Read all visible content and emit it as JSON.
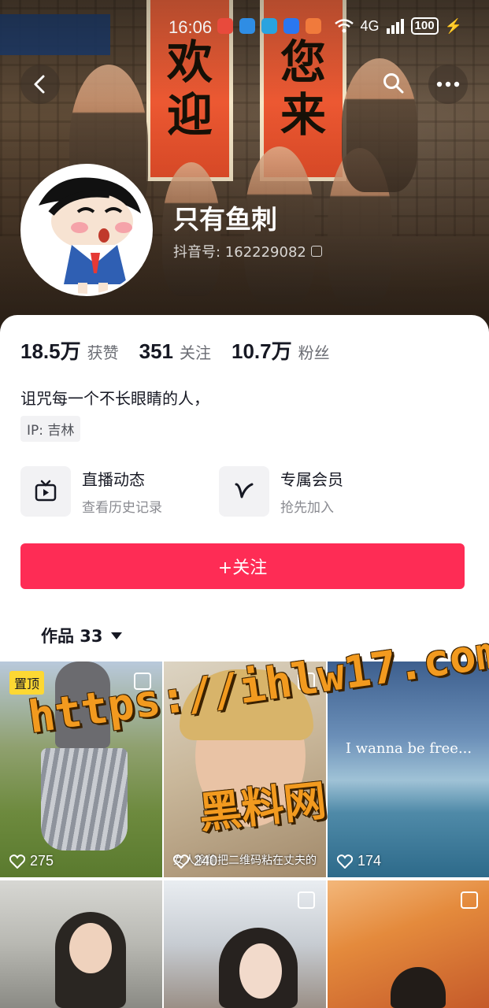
{
  "status_bar": {
    "time": "16:06",
    "network": "4G",
    "battery": "100"
  },
  "banner": {
    "scroll_left": [
      "欢",
      "迎"
    ],
    "scroll_right": [
      "您",
      "来"
    ]
  },
  "profile": {
    "nickname": "只有鱼刺",
    "douyin_id_label": "抖音号: 162229082"
  },
  "stats": [
    {
      "num": "18.5万",
      "label": "获赞"
    },
    {
      "num": "351",
      "label": "关注"
    },
    {
      "num": "10.7万",
      "label": "粉丝"
    }
  ],
  "bio": "诅咒每一个不长眼睛的人，",
  "ip_tag": "IP: 吉林",
  "features": {
    "live": {
      "title": "直播动态",
      "subtitle": "查看历史记录",
      "icon": "tv-icon"
    },
    "member": {
      "title": "专属会员",
      "subtitle": "抢先加入",
      "icon": "v-icon"
    }
  },
  "follow_button": "+关注",
  "works_tab": "作品 33",
  "videos": [
    {
      "likes": "275",
      "pinned_label": "置顶",
      "multi": true
    },
    {
      "likes": "240",
      "caption": "女人偷偷把二维码粘在丈夫的",
      "multi": true
    },
    {
      "likes": "174",
      "overlay_text": "I wanna be free..."
    },
    {
      "likes": ""
    },
    {
      "likes": "",
      "multi": true
    },
    {
      "likes": "",
      "multi": true
    }
  ],
  "watermark": {
    "url": "https://ihlw17.com",
    "cn": "黑料网"
  },
  "colors": {
    "follow_red": "#fe2c55",
    "pin_yellow": "#fdd833",
    "watermark_orange": "#f29a1f"
  }
}
